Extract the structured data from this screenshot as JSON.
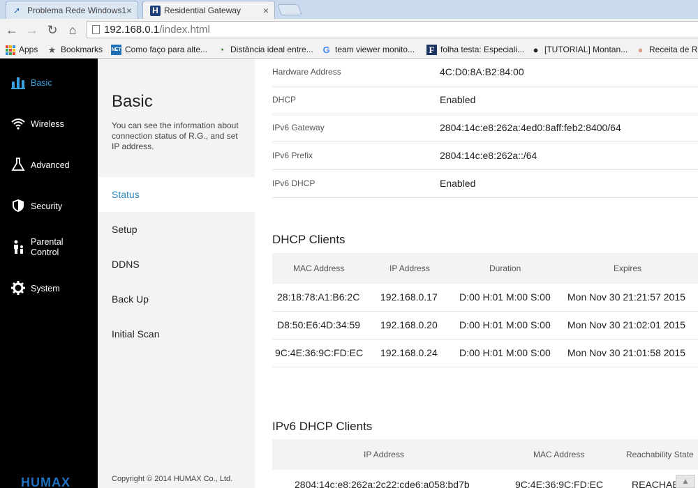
{
  "browser": {
    "tabs": [
      {
        "title": "Problema Rede Windows1",
        "active": false
      },
      {
        "title": "Residential Gateway",
        "active": true
      }
    ],
    "url_host": "192.168.0.1",
    "url_path": "/index.html",
    "bookmarks": [
      {
        "label": "Apps",
        "icon": "apps-grid-icon"
      },
      {
        "label": "Bookmarks",
        "icon": "star-icon"
      },
      {
        "label": "Como faço para alte...",
        "icon": "net-icon"
      },
      {
        "label": "Distância ideal entre...",
        "icon": "site-icon"
      },
      {
        "label": "team viewer monito...",
        "icon": "google-icon"
      },
      {
        "label": "folha testa: Especiali...",
        "icon": "folha-icon"
      },
      {
        "label": "[TUTORIAL] Montan...",
        "icon": "site-icon"
      },
      {
        "label": "Receita de Ris",
        "icon": "site-icon"
      }
    ]
  },
  "sidebar": {
    "items": [
      {
        "label": "Basic",
        "icon": "bar-chart-icon",
        "active": true
      },
      {
        "label": "Wireless",
        "icon": "wifi-icon",
        "active": false
      },
      {
        "label": "Advanced",
        "icon": "flask-icon",
        "active": false
      },
      {
        "label": "Security",
        "icon": "shield-icon",
        "active": false
      },
      {
        "label_line1": "Parental",
        "label_line2": "Control",
        "icon": "parent-child-icon",
        "active": false
      },
      {
        "label": "System",
        "icon": "gear-icon",
        "active": false
      }
    ],
    "logo": "HUMAX"
  },
  "subpanel": {
    "title": "Basic",
    "description": "You can see the information about connection status of R.G., and set IP address.",
    "items": [
      {
        "label": "Status",
        "active": true
      },
      {
        "label": "Setup",
        "active": false
      },
      {
        "label": "DDNS",
        "active": false
      },
      {
        "label": "Back Up",
        "active": false
      },
      {
        "label": "Initial Scan",
        "active": false
      }
    ],
    "copyright": "Copyright © 2014 HUMAX Co., Ltd."
  },
  "status": {
    "rows": [
      {
        "key": "Hardware Address",
        "value": "4C:D0:8A:B2:84:00"
      },
      {
        "key": "DHCP",
        "value": "Enabled"
      },
      {
        "key": "IPv6 Gateway",
        "value": "2804:14c:e8:262a:4ed0:8aff:feb2:8400/64"
      },
      {
        "key": "IPv6 Prefix",
        "value": "2804:14c:e8:262a::/64"
      },
      {
        "key": "IPv6 DHCP",
        "value": "Enabled"
      }
    ]
  },
  "dhcp_clients": {
    "title": "DHCP Clients",
    "columns": [
      "MAC Address",
      "IP Address",
      "Duration",
      "Expires"
    ],
    "rows": [
      [
        "28:18:78:A1:B6:2C",
        "192.168.0.17",
        "D:00 H:01 M:00 S:00",
        "Mon Nov 30 21:21:57 2015"
      ],
      [
        "D8:50:E6:4D:34:59",
        "192.168.0.20",
        "D:00 H:01 M:00 S:00",
        "Mon Nov 30 21:02:01 2015"
      ],
      [
        "9C:4E:36:9C:FD:EC",
        "192.168.0.24",
        "D:00 H:01 M:00 S:00",
        "Mon Nov 30 21:01:58 2015"
      ]
    ]
  },
  "ipv6_clients": {
    "title": "IPv6 DHCP Clients",
    "columns": [
      "IP Address",
      "MAC Address",
      "Reachability State"
    ],
    "rows": [
      [
        "2804:14c:e8:262a:2c22:cde6:a058:bd7b",
        "9C:4E:36:9C:FD:EC",
        "REACHABLE"
      ]
    ]
  },
  "colors": {
    "accent": "#2f8bc2",
    "sidebar_bg": "#000000",
    "panel_bg": "#f4f3f1",
    "logo": "#1d6fbf"
  }
}
